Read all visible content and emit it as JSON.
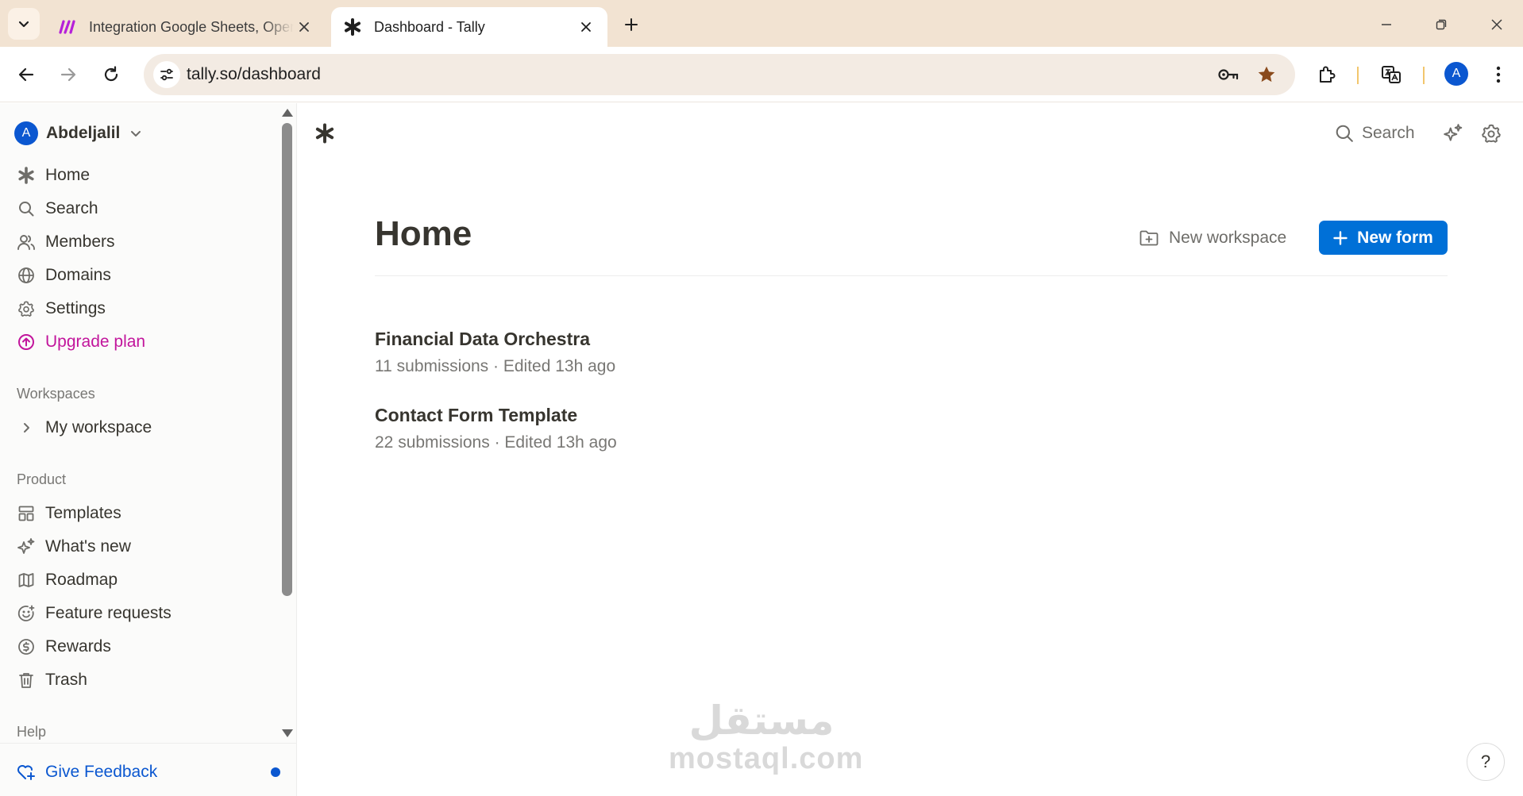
{
  "browser": {
    "tabs": [
      {
        "title": "Integration Google Sheets, OpenAI",
        "active": false
      },
      {
        "title": "Dashboard - Tally",
        "active": true
      }
    ],
    "url": "tally.so/dashboard",
    "profile_initial": "A"
  },
  "sidebar": {
    "user": {
      "initial": "A",
      "name": "Abdeljalil"
    },
    "nav": [
      {
        "label": "Home",
        "icon": "tally-star-icon"
      },
      {
        "label": "Search",
        "icon": "search-icon"
      },
      {
        "label": "Members",
        "icon": "members-icon"
      },
      {
        "label": "Domains",
        "icon": "globe-icon"
      },
      {
        "label": "Settings",
        "icon": "gear-icon"
      },
      {
        "label": "Upgrade plan",
        "icon": "upgrade-icon"
      }
    ],
    "workspaces_label": "Workspaces",
    "workspaces": [
      {
        "label": "My workspace"
      }
    ],
    "product_label": "Product",
    "product": [
      {
        "label": "Templates",
        "icon": "templates-icon"
      },
      {
        "label": "What's new",
        "icon": "sparkles-icon"
      },
      {
        "label": "Roadmap",
        "icon": "map-icon"
      },
      {
        "label": "Feature requests",
        "icon": "smile-icon"
      },
      {
        "label": "Rewards",
        "icon": "dollar-coin-icon"
      },
      {
        "label": "Trash",
        "icon": "trash-icon"
      }
    ],
    "help_label": "Help",
    "feedback_label": "Give Feedback"
  },
  "main": {
    "search_label": "Search",
    "title": "Home",
    "new_workspace_label": "New workspace",
    "new_form_label": "New form",
    "forms": [
      {
        "name": "Financial Data Orchestra",
        "meta": "11 submissions · Edited 13h ago"
      },
      {
        "name": "Contact Form Template",
        "meta": "22 submissions · Edited 13h ago"
      }
    ]
  },
  "watermark": {
    "arabic": "مستقل",
    "latin": "mostaql.com"
  },
  "help_button_label": "?",
  "colors": {
    "accent": "#0070d7",
    "upgrade": "#c2159c",
    "feedback": "#0b57d0",
    "tabbar": "#f2e3d2",
    "text": "#37352f",
    "muted": "#787774"
  }
}
